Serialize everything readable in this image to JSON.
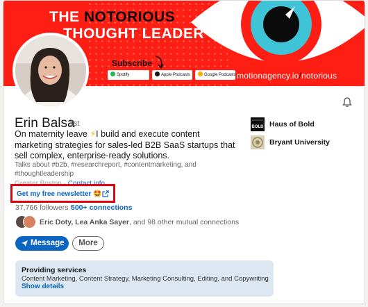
{
  "banner": {
    "title_part1": "THE ",
    "title_bold": "NOTORIOUS",
    "title_line2": "THOUGHT LEADER",
    "subscribe": "Subscribe",
    "platforms": [
      "Spotify",
      "Apple Podcasts",
      "Google Podcasts"
    ],
    "website_prefix": "motionagency.io",
    "website_slash": "/",
    "website_suffix": "notorious"
  },
  "profile": {
    "name": "Erin Balsa",
    "degree": "· 1st",
    "headline_pre": "On maternity leave ",
    "headline_post": "I build and execute content marketing strategies for sales-led B2B SaaS startups that sell complex, enterprise-ready solutions.",
    "talks_about": "Talks about #b2b, #researchreport, #contentmarketing, and #thoughtleadership",
    "location": "Greater Boston",
    "contact_info": "Contact info",
    "newsletter_link": "Get my free newsletter",
    "followers": "37,766 followers",
    "separator": "·",
    "connections": "500+ connections",
    "mutual_names": "Eric Doty, Lea Anka Sayer",
    "mutual_rest": ", and 98 other mutual connections"
  },
  "actions": {
    "message": "Message",
    "more": "More"
  },
  "services": {
    "title": "Providing services",
    "list": "Content Marketing, Content Strategy, Marketing Consulting, Editing, and Copywriting",
    "show_details": "Show details"
  },
  "experience": [
    {
      "name": "Haus of Bold",
      "logo_text": "BOLD"
    },
    {
      "name": "Bryant University"
    }
  ],
  "colors": {
    "banner_red": "#ff1e14",
    "linkedin_blue": "#0a66c2",
    "highlight_red": "#e3000f",
    "services_bg": "#dde7f1"
  }
}
